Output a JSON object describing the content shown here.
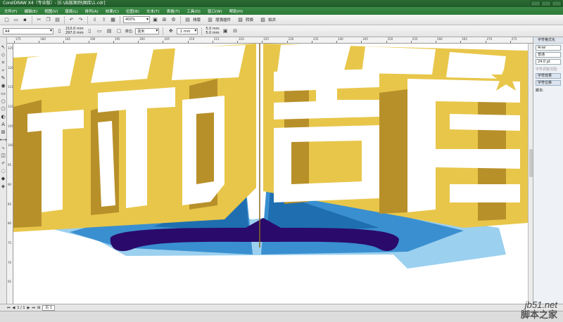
{
  "window": {
    "title": "CorelDRAW X4（专业版）- [E:\\出版案例\\图库\\1.cdr]"
  },
  "menu": [
    "文件(F)",
    "编辑(E)",
    "视图(V)",
    "版面(L)",
    "排列(A)",
    "效果(C)",
    "位图(B)",
    "文本(T)",
    "表格(T)",
    "工具(O)",
    "窗口(W)",
    "帮助(H)"
  ],
  "toolbar": {
    "zoom": "400%",
    "groups": [
      {
        "label": "排版",
        "icon": "layout-icon"
      },
      {
        "label": "增强插件",
        "icon": "plugin-icon"
      },
      {
        "label": "转换",
        "icon": "convert-icon"
      },
      {
        "label": "拟并",
        "icon": "merge-icon"
      }
    ]
  },
  "propbar": {
    "page_size": "A4",
    "width": "210.0 mm",
    "height": "297.0 mm",
    "unit_label": "单位:",
    "unit": "毫米",
    "nudge": ".1 mm",
    "dup_x": "5.0 mm",
    "dup_y": "5.0 mm"
  },
  "ruler": {
    "h_labels": [
      "175",
      "180",
      "185",
      "190",
      "195",
      "200",
      "205",
      "210",
      "215",
      "220",
      "225",
      "230",
      "235",
      "240",
      "245",
      "250",
      "255",
      "260",
      "265",
      "270",
      "275"
    ],
    "v_labels": [
      "125",
      "120",
      "115",
      "110",
      "105",
      "100",
      "95",
      "90",
      "85",
      "80",
      "75",
      "70",
      "65"
    ]
  },
  "docker": {
    "title": "字符格式化",
    "font": "Arial",
    "style": "普通",
    "size": "24.0 pt",
    "kerning_label": "字符调整范围:",
    "effects_btn": "字符效果",
    "shift_btn": "字符位移",
    "script_label": "脚本:"
  },
  "pages": {
    "current": "1 / 1",
    "tab": "页 1"
  },
  "watermark": {
    "url": "jb51.net",
    "name": "脚本之家"
  },
  "colors": {
    "gold": "#e8c64a",
    "gold_dark": "#b8902a",
    "blue": "#3a8fd0",
    "light_blue": "#9bd0ef",
    "navy": "#2a0a6a",
    "menubar": "#2d7a38"
  }
}
